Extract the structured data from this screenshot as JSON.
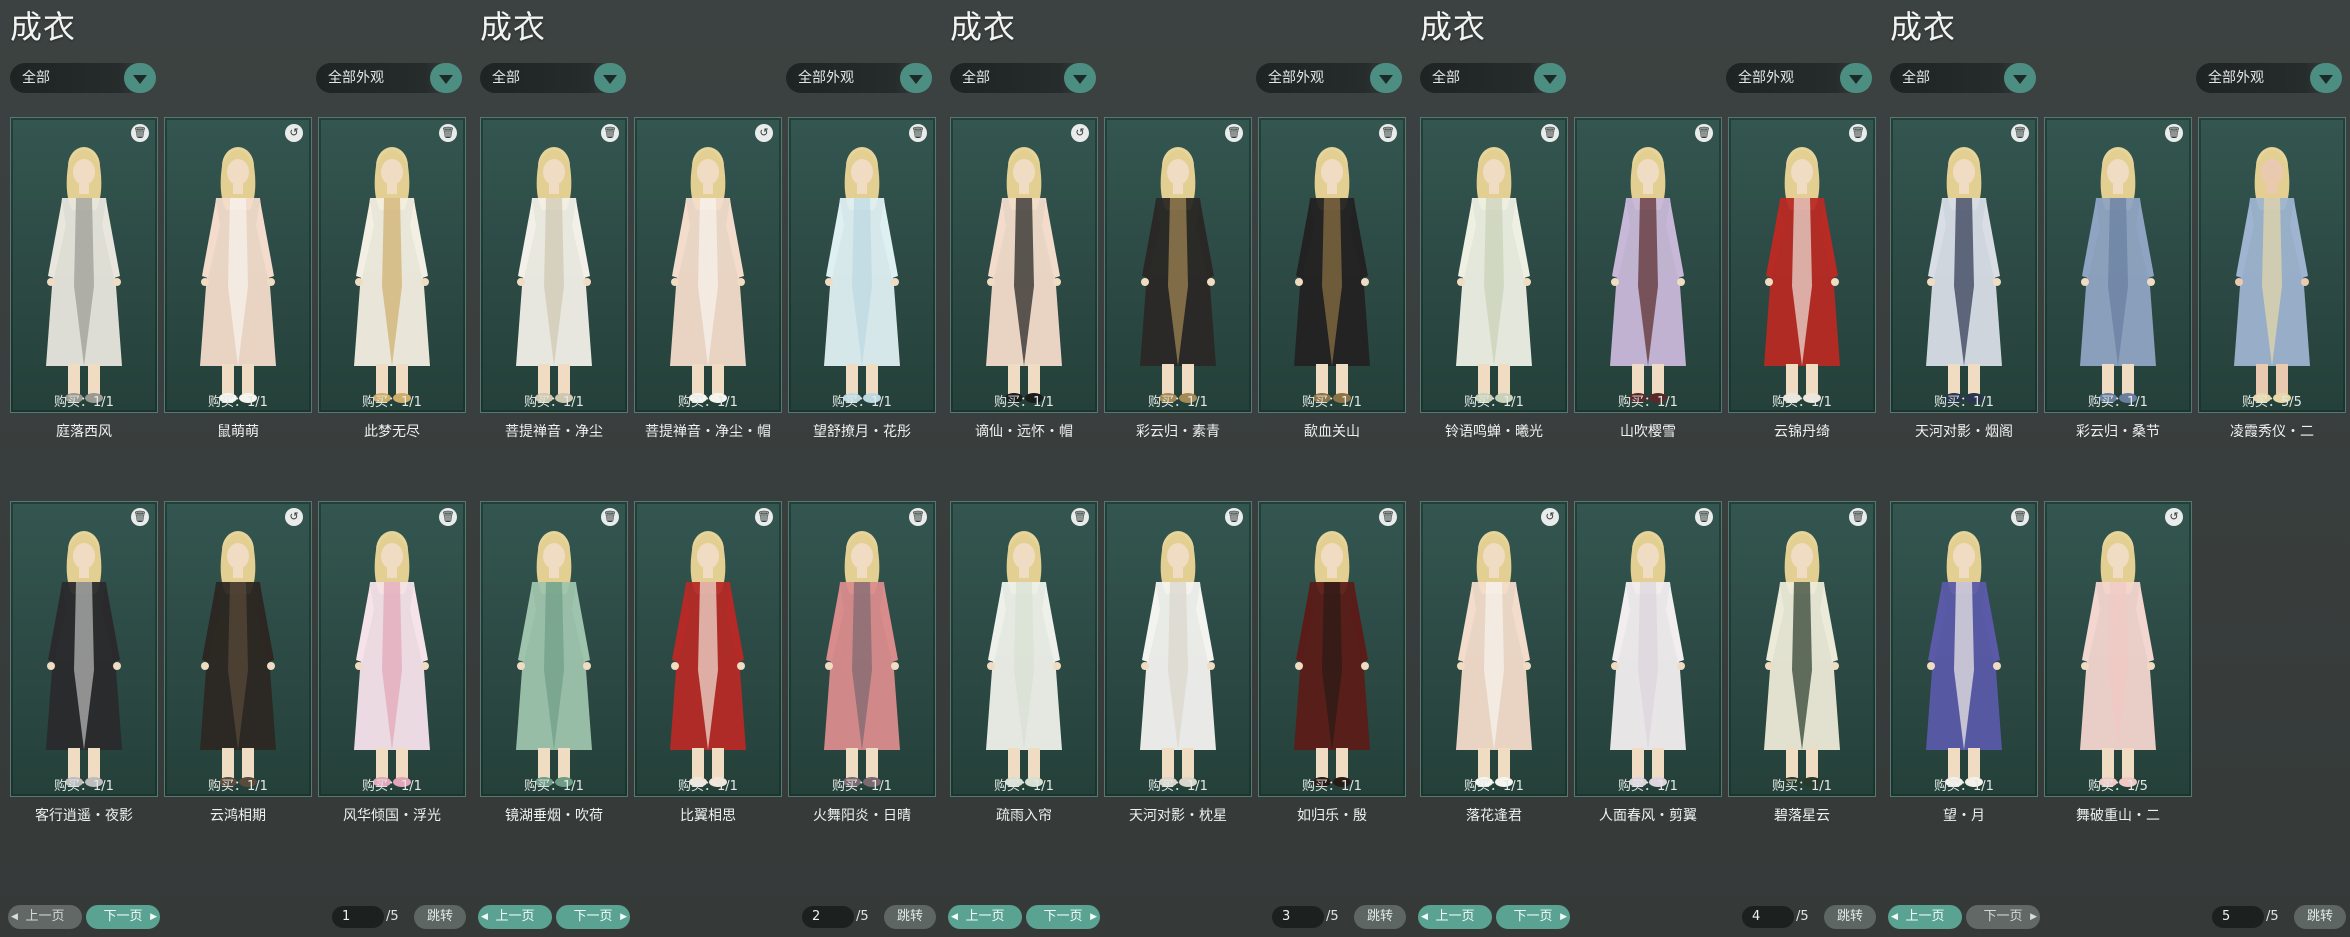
{
  "panels": [
    {
      "title": "成衣",
      "filter_category": "全部",
      "filter_appearance": "全部外观",
      "prev_label": "上一页",
      "next_label": "下一页",
      "prev_enabled": false,
      "next_enabled": true,
      "page_input": "1",
      "page_total": "/5",
      "jump_label": "跳转",
      "items": [
        {
          "name": "庭落西风",
          "buy": "购买：1/1",
          "icon": "trash-icon",
          "palette": [
            "#e8e6dd",
            "#9a9a92",
            "#f0dcc2"
          ]
        },
        {
          "name": "鼠萌萌",
          "buy": "购买：1/1",
          "icon": "cart-icon",
          "palette": [
            "#f3dccb",
            "#f6f4ef",
            "#f0dcc2"
          ]
        },
        {
          "name": "此梦无尽",
          "buy": "购买：1/1",
          "icon": "trash-icon",
          "palette": [
            "#f3efe2",
            "#cfae6a",
            "#f0dcc2"
          ]
        },
        {
          "name": "客行逍遥・夜影",
          "buy": "购买：1/1",
          "icon": "trash-icon",
          "palette": [
            "#2a2a2c",
            "#bdbdbd",
            "#f0dcc2"
          ]
        },
        {
          "name": "云鸿相期",
          "buy": "购买：1/1",
          "icon": "cart-icon",
          "palette": [
            "#2c2722",
            "#5a4a3a",
            "#f0dcc2"
          ]
        },
        {
          "name": "风华倾国・浮光",
          "buy": "购买：1/1",
          "icon": "trash-icon",
          "palette": [
            "#f6e3ea",
            "#e3a5b7",
            "#f0dcc2"
          ]
        }
      ]
    },
    {
      "title": "成衣",
      "filter_category": "全部",
      "filter_appearance": "全部外观",
      "prev_label": "上一页",
      "next_label": "下一页",
      "prev_enabled": true,
      "next_enabled": true,
      "page_input": "2",
      "page_total": "/5",
      "jump_label": "跳转",
      "items": [
        {
          "name": "菩提禅音・净尘",
          "buy": "购买：1/1",
          "icon": "trash-icon",
          "palette": [
            "#f2f0e8",
            "#cfc7b0",
            "#f0dcc2"
          ]
        },
        {
          "name": "菩提禅音・净尘・帽",
          "buy": "购买：1/1",
          "icon": "cart-icon",
          "palette": [
            "#f3dccb",
            "#f6f4ef",
            "#f0dcc2"
          ]
        },
        {
          "name": "望舒撩月・花彤",
          "buy": "购买：1/1",
          "icon": "trash-icon",
          "palette": [
            "#dff0f3",
            "#bcd9e2",
            "#f0dcc2"
          ]
        },
        {
          "name": "镜湖垂烟・吹荷",
          "buy": "购买：1/1",
          "icon": "trash-icon",
          "palette": [
            "#9ec4ad",
            "#6f9c86",
            "#f0dcc2"
          ]
        },
        {
          "name": "比翼相思",
          "buy": "购买：1/1",
          "icon": "trash-icon",
          "palette": [
            "#b52a26",
            "#f2e6da",
            "#f0dcc2"
          ]
        },
        {
          "name": "火舞阳炎・日晴",
          "buy": "购买：1/1",
          "icon": "trash-icon",
          "palette": [
            "#d98c8c",
            "#7b6870",
            "#f0dcc2"
          ]
        }
      ]
    },
    {
      "title": "成衣",
      "filter_category": "全部",
      "filter_appearance": "全部外观",
      "prev_label": "上一页",
      "next_label": "下一页",
      "prev_enabled": true,
      "next_enabled": true,
      "page_input": "3",
      "page_total": "/5",
      "jump_label": "跳转",
      "items": [
        {
          "name": "谪仙・远怀・帽",
          "buy": "购买：1/1",
          "icon": "cart-icon",
          "palette": [
            "#f3dccb",
            "#1c1c1c",
            "#f0dcc2"
          ]
        },
        {
          "name": "彩云归・素青",
          "buy": "购买：1/1",
          "icon": "trash-icon",
          "palette": [
            "#2a2826",
            "#a58a55",
            "#f0dcc2"
          ]
        },
        {
          "name": "歃血关山",
          "buy": "购买：1/1",
          "icon": "trash-icon",
          "palette": [
            "#232222",
            "#8e7444",
            "#f0dcc2"
          ]
        },
        {
          "name": "疏雨入帘",
          "buy": "购买：1/1",
          "icon": "trash-icon",
          "palette": [
            "#eef1ea",
            "#d8dfd3",
            "#f0dcc2"
          ]
        },
        {
          "name": "天河对影・枕星",
          "buy": "购买：1/1",
          "icon": "trash-icon",
          "palette": [
            "#f3f3f0",
            "#dad6cc",
            "#f0dcc2"
          ]
        },
        {
          "name": "如归乐・殷",
          "buy": "购买：1/1",
          "icon": "trash-icon",
          "palette": [
            "#5a1c18",
            "#2a1a16",
            "#f0dcc2"
          ]
        }
      ]
    },
    {
      "title": "成衣",
      "filter_category": "全部",
      "filter_appearance": "全部外观",
      "prev_label": "上一页",
      "next_label": "下一页",
      "prev_enabled": true,
      "next_enabled": true,
      "page_input": "4",
      "page_total": "/5",
      "jump_label": "跳转",
      "items": [
        {
          "name": "铃语鸣蝉・曦光",
          "buy": "购买：1/1",
          "icon": "trash-icon",
          "palette": [
            "#eef0e4",
            "#c9d1b8",
            "#f0dcc2"
          ]
        },
        {
          "name": "山吹樱雪",
          "buy": "购买：1/1",
          "icon": "trash-icon",
          "palette": [
            "#c8b8d8",
            "#5a2a2a",
            "#f0dcc2"
          ]
        },
        {
          "name": "云锦丹绮",
          "buy": "购买：1/1",
          "icon": "trash-icon",
          "palette": [
            "#b82a24",
            "#ece6dc",
            "#f0dcc2"
          ]
        },
        {
          "name": "落花逢君",
          "buy": "购买：1/1",
          "icon": "cart-icon",
          "palette": [
            "#f3dccb",
            "#f6f4ef",
            "#f0dcc2"
          ]
        },
        {
          "name": "人面春风・剪翼",
          "buy": "购买：1/1",
          "icon": "trash-icon",
          "palette": [
            "#f2eef0",
            "#ddd4dc",
            "#f0dcc2"
          ]
        },
        {
          "name": "碧落星云",
          "buy": "购买：1/1",
          "icon": "trash-icon",
          "palette": [
            "#ecead8",
            "#2a3a2a",
            "#f0dcc2"
          ]
        }
      ]
    },
    {
      "title": "成衣",
      "filter_category": "全部",
      "filter_appearance": "全部外观",
      "prev_label": "上一页",
      "next_label": "下一页",
      "prev_enabled": true,
      "next_enabled": false,
      "page_input": "5",
      "page_total": "/5",
      "jump_label": "跳转",
      "items": [
        {
          "name": "天河对影・烟阁",
          "buy": "购买：1/1",
          "icon": "trash-icon",
          "palette": [
            "#d8dde6",
            "#2c3550",
            "#f0dcc2"
          ]
        },
        {
          "name": "彩云归・桑节",
          "buy": "购买：1/1",
          "icon": "trash-icon",
          "palette": [
            "#8fa4c2",
            "#6a7fa0",
            "#f0dcc2"
          ]
        },
        {
          "name": "凌霞秀仪・二",
          "buy": "购买：5/5",
          "icon": "none",
          "palette": [
            "#9eb4d0",
            "#e8d8a8",
            "#e9c9b0"
          ]
        },
        {
          "name": "望・月",
          "buy": "购买：1/1",
          "icon": "trash-icon",
          "palette": [
            "#5a5aa8",
            "#f3f0ea",
            "#f0dcc2"
          ]
        },
        {
          "name": "舞破重山・二",
          "buy": "购买：1/5",
          "icon": "cart-icon",
          "palette": [
            "#f3d6cf",
            "#f1c9c4",
            "#f0dcc2"
          ]
        }
      ]
    }
  ],
  "colors": {
    "accent": "#5aa393",
    "card_bg": "#2c4944",
    "page_bg": "#3a3f3e"
  }
}
